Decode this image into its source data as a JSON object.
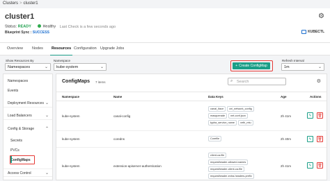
{
  "breadcrumb": {
    "root": "Clusters",
    "separator": ">",
    "current": "cluster1"
  },
  "header": {
    "title": "cluster1",
    "status_label": "Status:",
    "status_value": "READY",
    "health": "Healthy",
    "last_check": "Last Check is a few seconds ago",
    "blueprint_label": "Blueprint Sync :",
    "blueprint_value": "SUCCESS",
    "kubectl_label": "KUBECTL",
    "colors": {
      "ready": "#1a9e4a",
      "healthy_dot": "#2eaa4d",
      "success": "#1b6ecf"
    }
  },
  "tabs": [
    "Overview",
    "Nodes",
    "Resources",
    "Configuration",
    "Upgrade Jobs"
  ],
  "active_tab": "Resources",
  "filters": {
    "show_resources_label": "Show Resources By",
    "show_resources_value": "Namespaces",
    "namespace_label": "Namespace",
    "namespace_value": "kube-system",
    "refresh_label": "Refresh Interval",
    "refresh_value": "1m"
  },
  "create_button": {
    "icon": "+",
    "label": "Create ConfigMap",
    "accent": "#1a9e87",
    "highlight": "#e53935"
  },
  "sidebar": {
    "items": [
      {
        "label": "Namespaces",
        "type": "item"
      },
      {
        "label": "Events",
        "type": "item"
      },
      {
        "label": "Deployment Resources",
        "type": "group",
        "chevron": "chevron-down-icon"
      },
      {
        "label": "Load Balancers",
        "type": "group",
        "chevron": "chevron-down-icon"
      },
      {
        "label": "Config & Storage",
        "type": "group",
        "chevron": "chevron-up-icon"
      },
      {
        "label": "Secrets",
        "type": "sub"
      },
      {
        "label": "PVCs",
        "type": "sub"
      },
      {
        "label": "ConfigMaps",
        "type": "sub",
        "selected": true
      },
      {
        "label": "Access Control",
        "type": "group",
        "chevron": "chevron-down-icon"
      }
    ]
  },
  "main": {
    "title": "ConfigMaps",
    "count": "7 items",
    "search_placeholder": "Search",
    "columns": [
      "Namespace",
      "Name",
      "Data Keys",
      "Age",
      "Actions"
    ],
    "rows": [
      {
        "namespace": "kube-system",
        "name": "canal-config",
        "keys": [
          "canal_iface",
          "cni_network_config",
          "masquerade",
          "net-conf.json",
          "typha_service_name",
          "veth_mtu"
        ],
        "age": "2h 41m"
      },
      {
        "namespace": "kube-system",
        "name": "coredns",
        "keys": [
          "Corefile"
        ],
        "age": "2h 40m"
      },
      {
        "namespace": "kube-system",
        "name": "extension-apiserver-authentication",
        "keys": [
          "client-ca-file",
          "requestheader-allowed-names",
          "requestheader-client-ca-file",
          "requestheader-extra-headers-prefix"
        ],
        "age": "2h 41m"
      }
    ]
  }
}
